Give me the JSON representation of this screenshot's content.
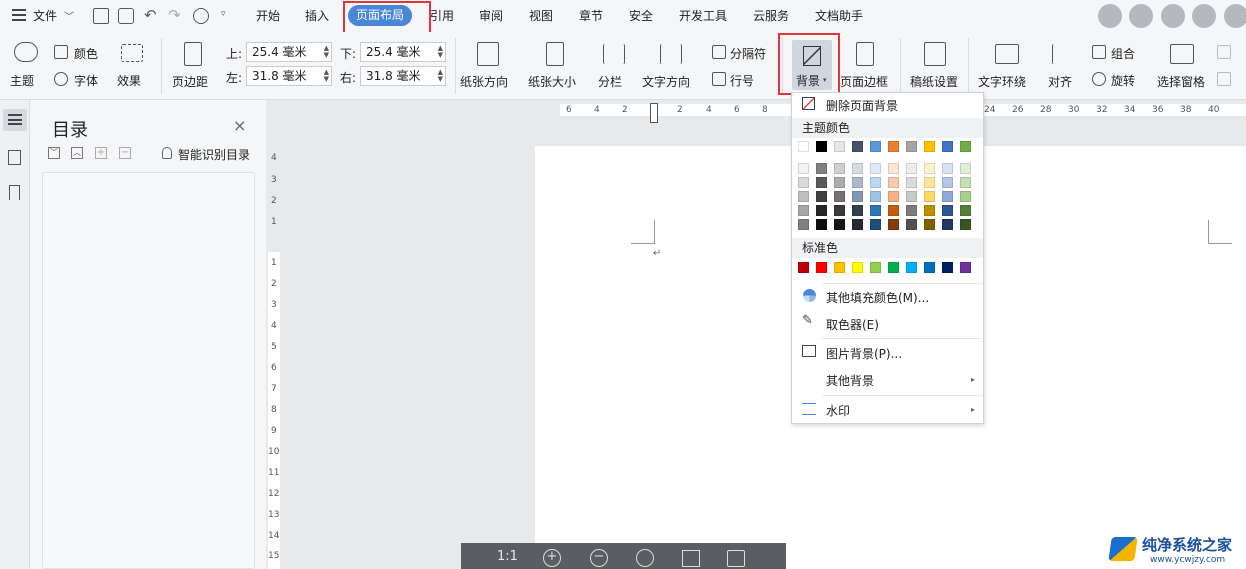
{
  "menubar": {
    "file_label": "文件",
    "tabs": [
      "开始",
      "插入",
      "页面布局",
      "引用",
      "审阅",
      "视图",
      "章节",
      "安全",
      "开发工具",
      "云服务",
      "文档助手"
    ],
    "active_tab": "页面布局"
  },
  "ribbon": {
    "theme": "主题",
    "colors": "颜色",
    "font": "字体",
    "effects": "效果",
    "margins": "页边距",
    "top_label": "上:",
    "top_value": "25.4 毫米",
    "bottom_label": "下:",
    "bottom_value": "25.4 毫米",
    "left_label": "左:",
    "left_value": "31.8 毫米",
    "right_label": "右:",
    "right_value": "31.8 毫米",
    "orientation": "纸张方向",
    "size": "纸张大小",
    "columns": "分栏",
    "text_direction": "文字方向",
    "breaks": "分隔符",
    "line_numbers": "行号",
    "background": "背景",
    "page_borders": "页面边框",
    "manuscript": "稿纸设置",
    "wrap_text": "文字环绕",
    "align": "对齐",
    "group": "组合",
    "rotate": "旋转",
    "selection_pane": "选择窗格"
  },
  "toc_panel": {
    "title": "目录",
    "smart_toc": "智能识别目录"
  },
  "ruler": {
    "h_numbers": [
      "6",
      "4",
      "2",
      "2",
      "4",
      "6",
      "8",
      "24",
      "26",
      "28",
      "30",
      "32",
      "34",
      "36",
      "38",
      "40"
    ],
    "v_numbers_top": [
      "4",
      "3",
      "2",
      "1"
    ],
    "v_numbers": [
      "1",
      "2",
      "3",
      "4",
      "5",
      "6",
      "7",
      "8",
      "9",
      "10",
      "11",
      "12",
      "13",
      "14",
      "15"
    ]
  },
  "bottombar": {
    "zoom_label": "1:1"
  },
  "dropdown": {
    "remove_bg": "删除页面背景",
    "theme_colors_header": "主题颜色",
    "standard_colors_header": "标准色",
    "more_fill": "其他填充颜色(M)...",
    "eyedropper": "取色器(E)",
    "picture_bg": "图片背景(P)...",
    "other_bg": "其他背景",
    "watermark": "水印"
  },
  "colors": {
    "accent": "#4a86d8",
    "highlight_border": "#e3343a",
    "theme_top_row": [
      "#ffffff",
      "#000000",
      "#e7e6e6",
      "#44546a",
      "#5b9bd5",
      "#ed7d31",
      "#a5a5a5",
      "#ffc000",
      "#4472c4",
      "#70ad47"
    ],
    "theme_shades": [
      [
        "#f2f2f2",
        "#808080",
        "#d0cece",
        "#d6dce4",
        "#deebf6",
        "#fbe5d6",
        "#ededed",
        "#fff2cc",
        "#d9e2f3",
        "#e2efd9"
      ],
      [
        "#d9d9d9",
        "#595959",
        "#aeabab",
        "#adb9ca",
        "#bdd7ee",
        "#f8cbad",
        "#dbdbdb",
        "#ffe699",
        "#b4c6e7",
        "#c5e0b3"
      ],
      [
        "#bfbfbf",
        "#404040",
        "#757171",
        "#8497b0",
        "#9dc3e6",
        "#f4b183",
        "#c9c9c9",
        "#ffd966",
        "#8eaadb",
        "#a8d08d"
      ],
      [
        "#a6a6a6",
        "#262626",
        "#3a3838",
        "#323f4f",
        "#2e75b5",
        "#c55a11",
        "#7b7b7b",
        "#bf9000",
        "#2f5496",
        "#538135"
      ],
      [
        "#808080",
        "#0d0d0d",
        "#171616",
        "#222a35",
        "#1f4e79",
        "#843c0c",
        "#525252",
        "#7f6000",
        "#1f3864",
        "#375623"
      ]
    ],
    "standard": [
      "#c00000",
      "#ff0000",
      "#ffc000",
      "#ffff00",
      "#92d050",
      "#00b050",
      "#00b0f0",
      "#0070c0",
      "#002060",
      "#7030a0"
    ]
  },
  "watermark_site": {
    "name": "纯净系统之家",
    "url": "www.ycwjzy.com"
  }
}
